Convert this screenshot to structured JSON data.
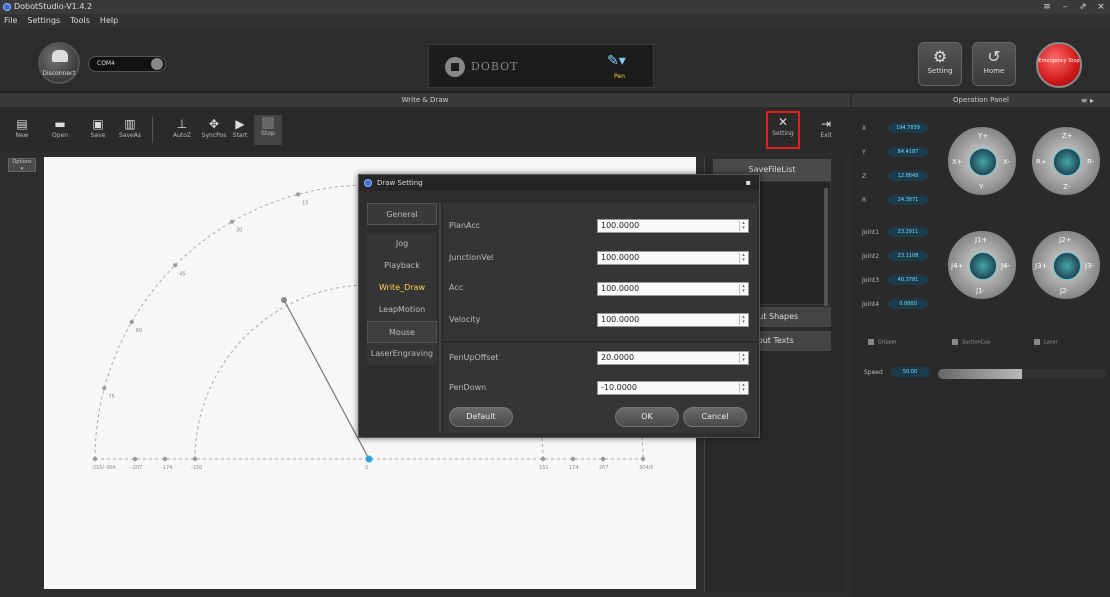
{
  "window": {
    "title": "DobotStudio-V1.4.2",
    "controls": [
      "≡",
      "–",
      "⇗",
      "×"
    ]
  },
  "menu": [
    "File",
    "Settings",
    "Tools",
    "Help"
  ],
  "topbar": {
    "disconnect_label": "Disconnect",
    "port": "COM4",
    "brand": "DOBOT",
    "tool_label": "Pen",
    "setting_label": "Setting",
    "home_label": "Home",
    "emergency_label": "Emergency Stop"
  },
  "write_draw": {
    "header": "Write & Draw",
    "toolbar": [
      "New",
      "Open",
      "Save",
      "SaveAs",
      "AutoZ",
      "SyncPos",
      "Start",
      "Stop"
    ],
    "setting_label": "Setting",
    "exit_label": "Exit",
    "options_label": "Options",
    "side": {
      "savefilelist": "SaveFileList",
      "input_shapes": "Input Shapes",
      "input_texts": "Input Texts"
    },
    "canvas_labels": {
      "arc_ticks": [
        "15",
        "30",
        "45",
        "60",
        "75"
      ],
      "axis_ticks": [
        "-315/-304",
        "-207",
        "-174",
        "-150",
        "0",
        "151",
        "174",
        "207",
        "304/5"
      ]
    }
  },
  "operation_panel": {
    "header": "Operation Panel",
    "coords": [
      {
        "axis": "X",
        "value": "194.7839"
      },
      {
        "axis": "Y",
        "value": "84.4187"
      },
      {
        "axis": "Z",
        "value": "12.8849"
      },
      {
        "axis": "R",
        "value": "24.3871"
      }
    ],
    "joints": [
      {
        "name": "Joint1",
        "value": "23.2911"
      },
      {
        "name": "Joint2",
        "value": "23.1108"
      },
      {
        "name": "Joint3",
        "value": "40.3781"
      },
      {
        "name": "Joint4",
        "value": "0.0000"
      }
    ],
    "cartesian_jogs": [
      {
        "up": "Y+",
        "down": "Y-",
        "left": "X+",
        "right": "X-"
      },
      {
        "up": "Z+",
        "down": "Z-",
        "left": "R+",
        "right": "R-"
      }
    ],
    "joint_jogs": [
      {
        "up": "J1+",
        "down": "J1-",
        "left": "J4+",
        "right": "J4-"
      },
      {
        "up": "J2+",
        "down": "J2-",
        "left": "J3+",
        "right": "J3-"
      }
    ],
    "checks": [
      "Gripper",
      "SuctionCup",
      "Laser"
    ],
    "speed_label": "Speed",
    "speed_value": "50.00",
    "speed_fraction": 0.5
  },
  "dialog": {
    "title": "Draw Setting",
    "nav": [
      "General",
      "Jog",
      "Playback",
      "Write_Draw",
      "LeapMotion",
      "Mouse",
      "LaserEngraving"
    ],
    "active_nav": "Write_Draw",
    "fields": [
      {
        "label": "PlanAcc",
        "value": "100.0000"
      },
      {
        "label": "JunctionVel",
        "value": "100.0000"
      },
      {
        "label": "Acc",
        "value": "100.0000"
      },
      {
        "label": "Velocity",
        "value": "100.0000"
      },
      {
        "label": "PenUpOffset",
        "value": "20.0000"
      },
      {
        "label": "PenDown",
        "value": "-10.0000"
      }
    ],
    "buttons": {
      "default": "Default",
      "ok": "OK",
      "cancel": "Cancel"
    }
  },
  "colors": {
    "accent_red": "#e02020",
    "active_nav": "#ffd84a",
    "estop": "#d01818",
    "readout": "#7fd8ff"
  }
}
